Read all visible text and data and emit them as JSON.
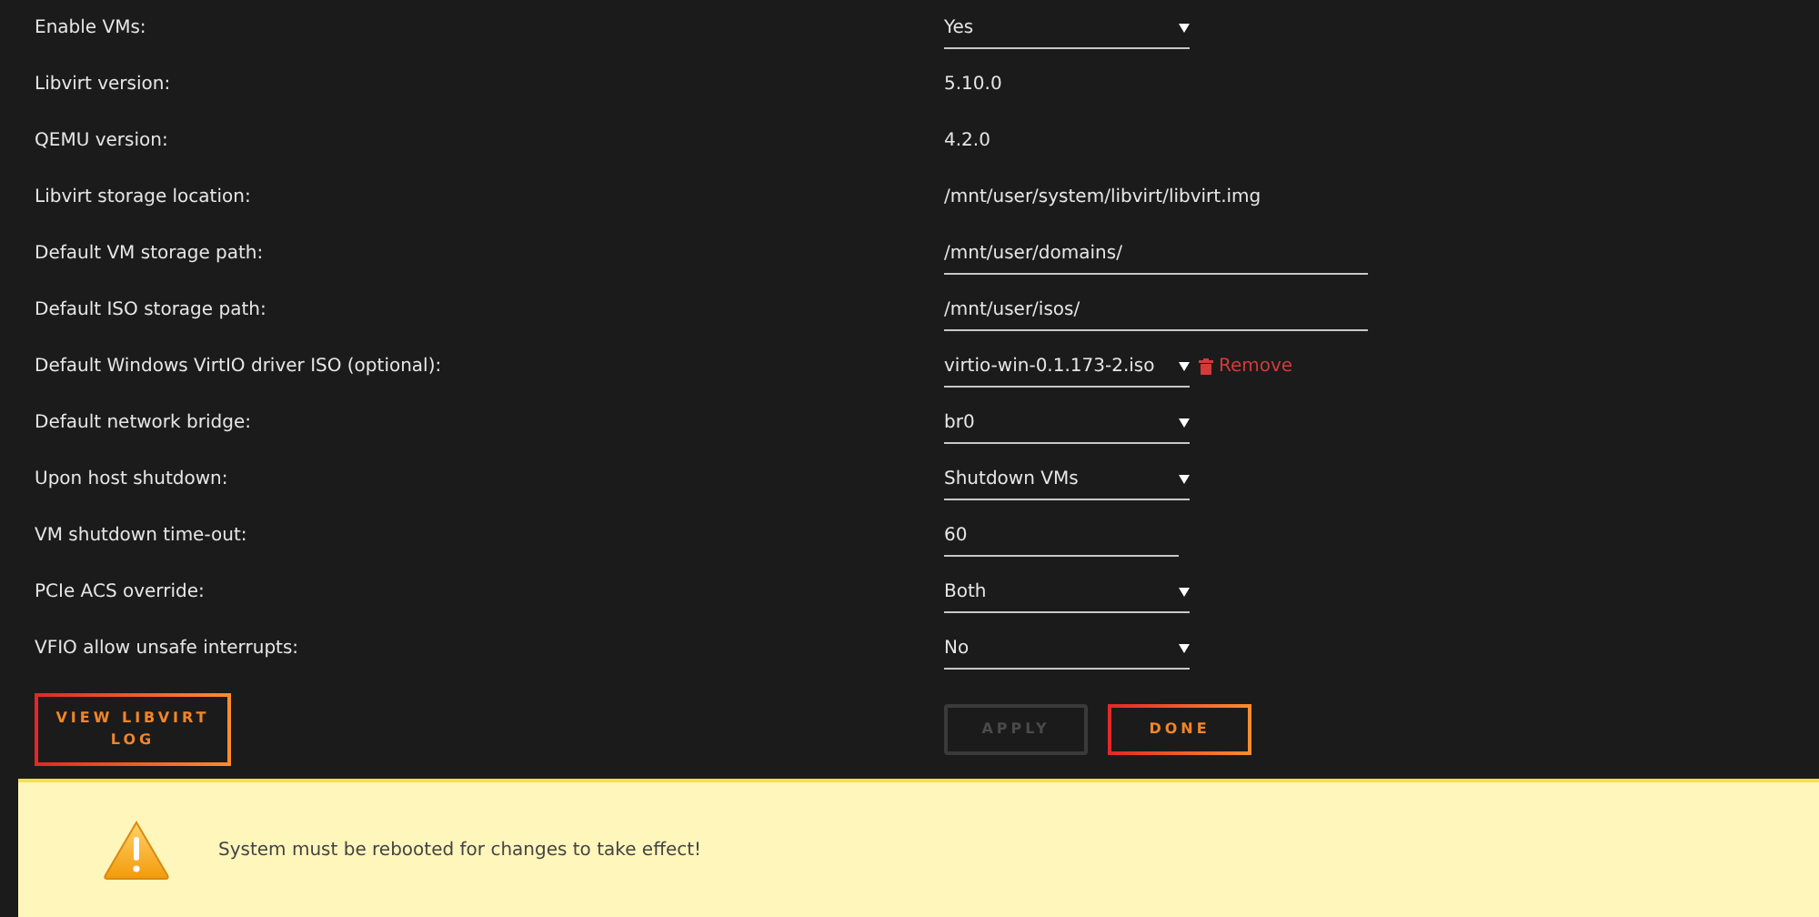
{
  "settings": [
    {
      "label": "Enable VMs:",
      "kind": "select",
      "value": "Yes"
    },
    {
      "label": "Libvirt version:",
      "kind": "text",
      "value": "5.10.0"
    },
    {
      "label": "QEMU version:",
      "kind": "text",
      "value": "4.2.0"
    },
    {
      "label": "Libvirt storage location:",
      "kind": "text",
      "value": "/mnt/user/system/libvirt/libvirt.img"
    },
    {
      "label": "Default VM storage path:",
      "kind": "input",
      "value": "/mnt/user/domains/"
    },
    {
      "label": "Default ISO storage path:",
      "kind": "input",
      "value": "/mnt/user/isos/"
    },
    {
      "label": "Default Windows VirtIO driver ISO (optional):",
      "kind": "select",
      "value": "virtio-win-0.1.173-2.iso",
      "action": "Remove"
    },
    {
      "label": "Default network bridge:",
      "kind": "select",
      "value": "br0"
    },
    {
      "label": "Upon host shutdown:",
      "kind": "select",
      "value": "Shutdown VMs"
    },
    {
      "label": "VM shutdown time-out:",
      "kind": "short_input",
      "value": "60"
    },
    {
      "label": "PCIe ACS override:",
      "kind": "select",
      "value": "Both"
    },
    {
      "label": "VFIO allow unsafe interrupts:",
      "kind": "select",
      "value": "No"
    }
  ],
  "log_button": {
    "label": "VIEW LIBVIRT LOG",
    "disabled": false
  },
  "buttons": [
    {
      "label": "APPLY",
      "disabled": true
    },
    {
      "label": "DONE",
      "disabled": false
    }
  ],
  "notice": {
    "text": "System must be rebooted for changes to take effect!"
  }
}
